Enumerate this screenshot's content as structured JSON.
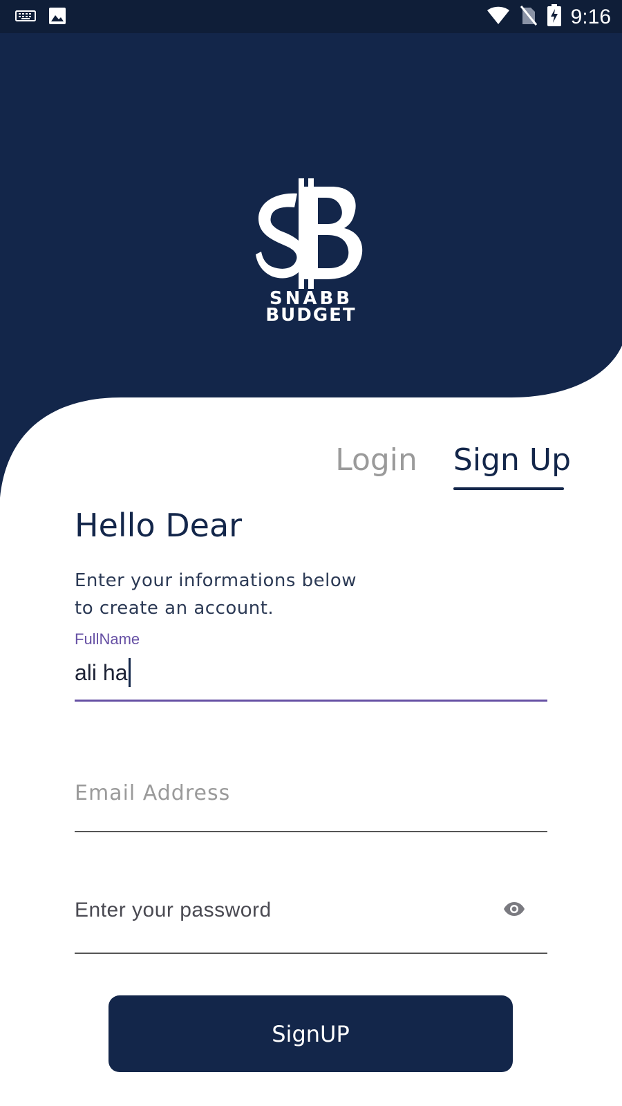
{
  "status_bar": {
    "time": "9:16",
    "left_icons": [
      "keyboard-icon",
      "image-icon"
    ],
    "right_icons": [
      "wifi-icon",
      "no-sim-icon",
      "battery-charging-icon"
    ]
  },
  "logo": {
    "line1": "SNABB",
    "line2": "BUDGET"
  },
  "tabs": {
    "login": "Login",
    "signup": "Sign Up",
    "active": "signup"
  },
  "form": {
    "greeting": "Hello Dear",
    "subtitle_line1": "Enter your informations below",
    "subtitle_line2": "to create an account.",
    "fullname": {
      "label": "FullName",
      "value": "ali ha"
    },
    "email": {
      "placeholder": "Email Address"
    },
    "password": {
      "placeholder": "Enter your password",
      "toggle_icon": "eye-icon"
    }
  },
  "button": {
    "label": "SignUP"
  },
  "colors": {
    "navy": "#13264a",
    "status_bar": "#0f1e38",
    "accent_purple": "#6650a4",
    "inactive_tab": "#9a9a9a",
    "background": "#ffffff"
  }
}
